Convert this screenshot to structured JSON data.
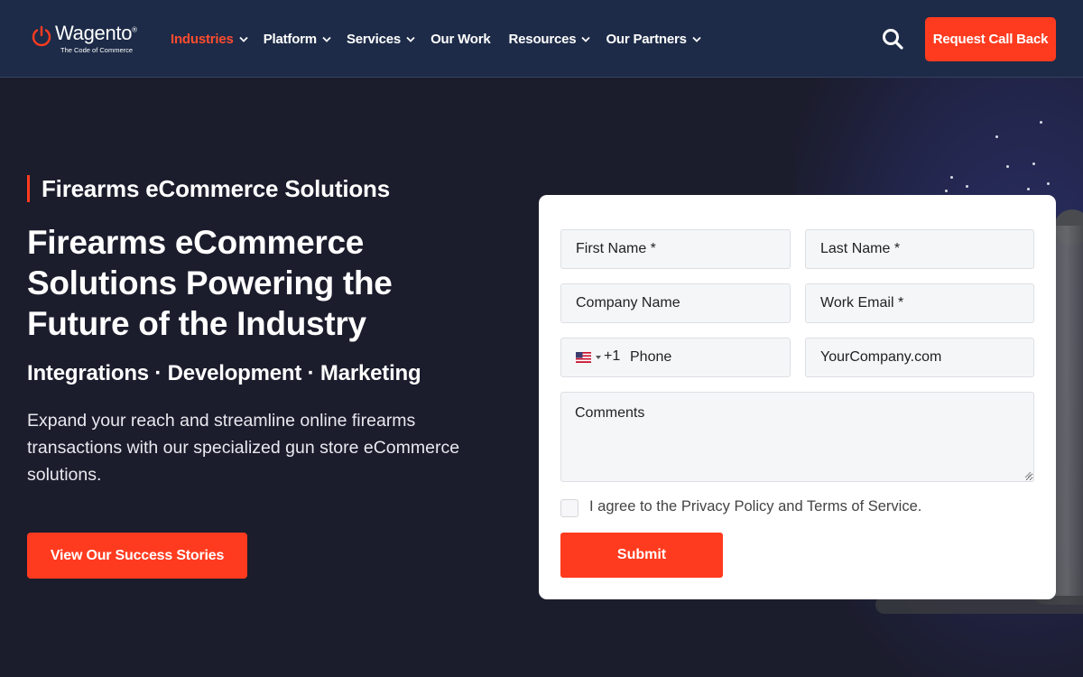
{
  "header": {
    "logo": {
      "brand": "Wagento",
      "registered": "®",
      "tagline": "The Code of Commerce"
    },
    "nav": [
      {
        "label": "Industries",
        "has_dropdown": true,
        "active": true
      },
      {
        "label": "Platform",
        "has_dropdown": true,
        "active": false
      },
      {
        "label": "Services",
        "has_dropdown": true,
        "active": false
      },
      {
        "label": "Our Work",
        "has_dropdown": false,
        "active": false
      },
      {
        "label": "Resources",
        "has_dropdown": true,
        "active": false
      },
      {
        "label": "Our Partners",
        "has_dropdown": true,
        "active": false
      }
    ],
    "search_icon": "search-icon",
    "cta_label": "Request Call Back"
  },
  "hero": {
    "eyebrow": "Firearms eCommerce Solutions",
    "headline": "Firearms eCommerce Solutions Powering the Future of the Industry",
    "subhead": "Integrations · Development · Marketing",
    "body": "Expand your reach and streamline online firearms transactions with our specialized gun store eCommerce solutions.",
    "cta_label": "View Our Success Stories"
  },
  "form": {
    "first_name_placeholder": "First Name *",
    "last_name_placeholder": "Last Name *",
    "company_placeholder": "Company Name",
    "email_placeholder": "Work Email *",
    "phone_country_icon": "us-flag-icon",
    "phone_dial_code": "+1",
    "phone_placeholder": "Phone",
    "website_placeholder": "YourCompany.com",
    "comments_placeholder": "Comments",
    "agree_label": "I agree to the Privacy Policy and Terms of Service.",
    "agree_checked": false,
    "submit_label": "Submit"
  },
  "colors": {
    "header_bg": "#1d2b48",
    "page_bg": "#1b1c2c",
    "accent": "#ff3b1f",
    "active_nav": "#ff4c2e",
    "form_bg": "#ffffff"
  }
}
